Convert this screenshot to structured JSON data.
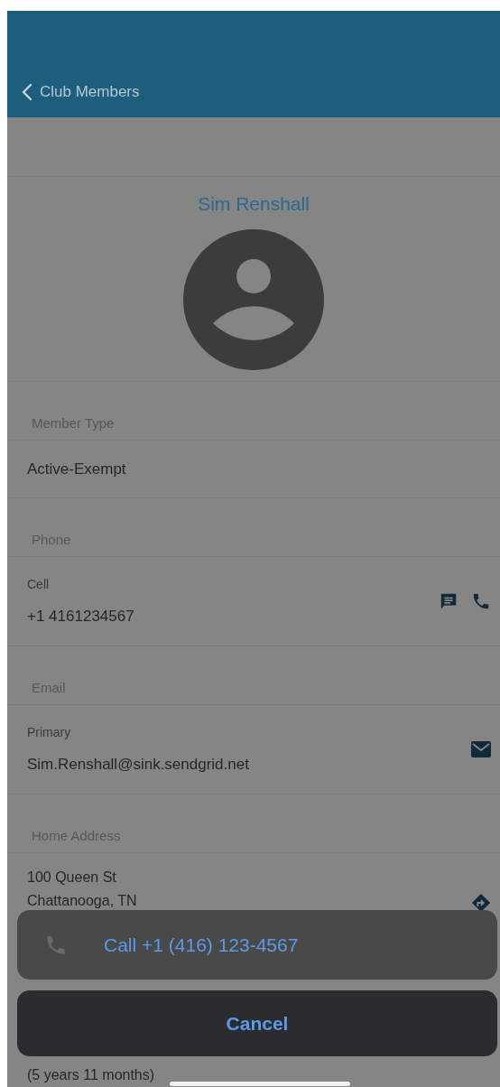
{
  "header": {
    "back_label": "Club Members"
  },
  "member": {
    "name": "Sim Renshall"
  },
  "sections": [
    {
      "kind": "plain",
      "title": "Member Type",
      "value": "Active-Exempt"
    },
    {
      "kind": "phone",
      "title": "Phone",
      "sublabel": "Cell",
      "value": "+1 4161234567"
    },
    {
      "kind": "email",
      "title": "Email",
      "sublabel": "Primary",
      "value": "Sim.Renshall@sink.sendgrid.net"
    },
    {
      "kind": "address",
      "title": "Home Address",
      "lines": [
        "100 Queen St",
        "Chattanooga, TN"
      ]
    },
    {
      "kind": "info",
      "lines": [
        "(5 years 11 months)"
      ]
    }
  ],
  "action_sheet": {
    "actions": [
      {
        "label": "Call +1 (416) 123-4567"
      }
    ],
    "cancel_label": "Cancel"
  }
}
